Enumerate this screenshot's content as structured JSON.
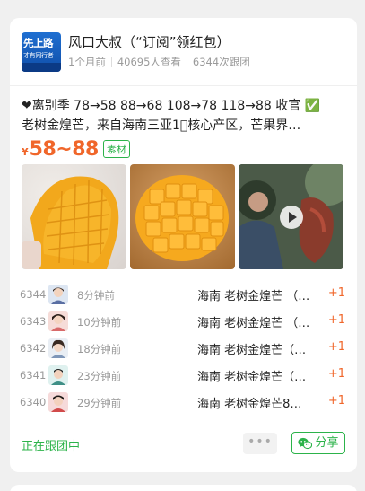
{
  "post": {
    "author": "风口大叔（“订阅”领红包）",
    "logo_line1": "先上路",
    "logo_line2": "才有同行者",
    "time_ago": "1个月前",
    "views": "40695人查看",
    "follow_count": "6344次跟团",
    "desc_line1_prefix": "❤离别季 78→58 88→68 108→78 118→88 收官 ",
    "desc_line1_check": "✅",
    "desc_line2": "老树金煌芒，来自海南三亚1⃣️核心产区，芒果界…",
    "price_symbol": "¥",
    "price_range": "58~88",
    "material_tag": "素材"
  },
  "photos": [
    {
      "name": "mango-photo-1"
    },
    {
      "name": "mango-photo-2"
    },
    {
      "name": "mango-video-3"
    }
  ],
  "records": [
    {
      "num": "6344",
      "time": "8分钟前",
      "product": "海南 老树金煌芒 （…",
      "qty": "+1"
    },
    {
      "num": "6343",
      "time": "10分钟前",
      "product": "海南 老树金煌芒 （…",
      "qty": "+1"
    },
    {
      "num": "6342",
      "time": "18分钟前",
      "product": "海南 老树金煌芒（…",
      "qty": "+1"
    },
    {
      "num": "6341",
      "time": "23分钟前",
      "product": "海南 老树金煌芒（…",
      "qty": "+1"
    },
    {
      "num": "6340",
      "time": "29分钟前",
      "product": "海南 老树金煌芒8…",
      "qty": "+1"
    }
  ],
  "footer": {
    "status": "正在跟团中",
    "more": "•••",
    "share": "分享"
  },
  "colors": {
    "accent_orange": "#f0662a",
    "accent_green": "#2cb34a"
  }
}
